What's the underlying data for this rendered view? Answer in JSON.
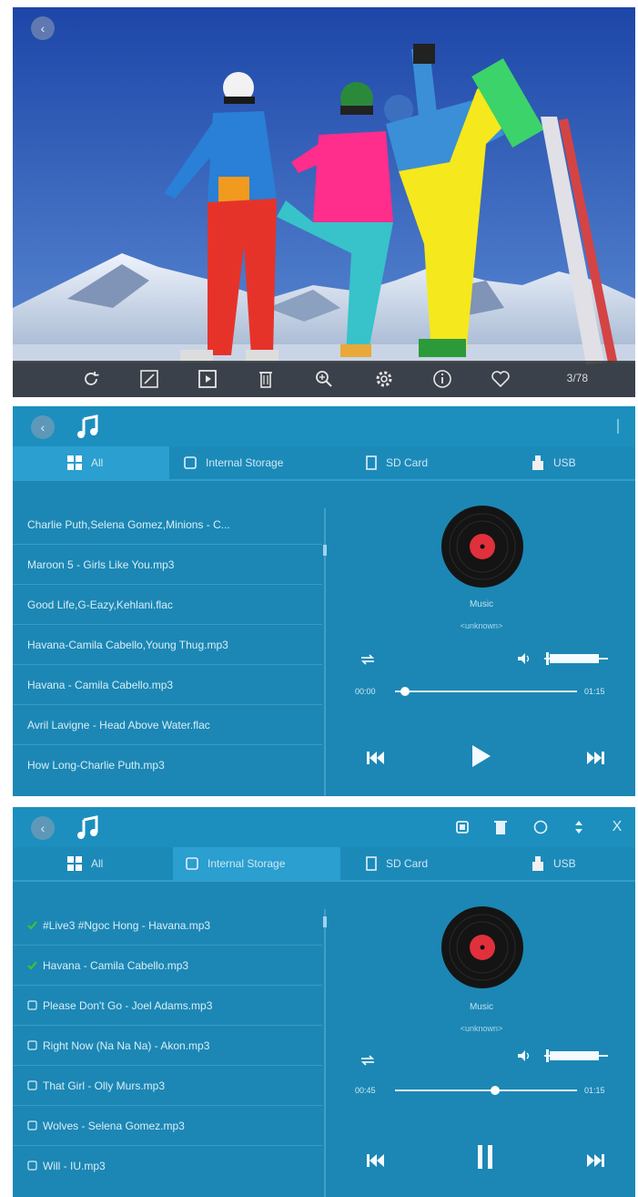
{
  "viewer": {
    "counter": "3/78",
    "toolbar_icons": [
      "rotate-icon",
      "fullscreen-icon",
      "slideshow-icon",
      "delete-icon",
      "zoom-icon",
      "settings-icon",
      "info-icon",
      "favorite-icon"
    ]
  },
  "music1": {
    "tabs": [
      {
        "label": "All",
        "icon": "grid-icon"
      },
      {
        "label": "Internal Storage",
        "icon": "storage-icon"
      },
      {
        "label": "SD Card",
        "icon": "sd-card-icon"
      },
      {
        "label": "USB",
        "icon": "usb-icon"
      }
    ],
    "active_tab": 0,
    "songs": [
      "Charlie Puth,Selena Gomez,Minions - C...",
      "Maroon 5 - Girls Like You.mp3",
      "Good Life,G-Eazy,Kehlani.flac",
      "Havana-Camila Cabello,Young Thug.mp3",
      "Havana - Camila Cabello.mp3",
      "Avril Lavigne - Head Above Water.flac",
      "How Long-Charlie Puth.mp3"
    ],
    "track_title": "Music",
    "track_artist": "<unknown>",
    "time_current": "00:00",
    "time_total": "01:15",
    "progress": 0.03,
    "volume": 0.85,
    "state": "paused"
  },
  "music2": {
    "tabs": [
      {
        "label": "All",
        "icon": "grid-icon"
      },
      {
        "label": "Internal Storage",
        "icon": "storage-icon"
      },
      {
        "label": "SD Card",
        "icon": "sd-card-icon"
      },
      {
        "label": "USB",
        "icon": "usb-icon"
      }
    ],
    "active_tab": 1,
    "top_actions": [
      "copy-icon",
      "delete-icon",
      "select-all-icon",
      "move-icon",
      "close-icon"
    ],
    "close_label": "X",
    "songs": [
      {
        "label": "#Live3 #Ngoc Hong - Havana.mp3",
        "checked": true
      },
      {
        "label": "Havana - Camila Cabello.mp3",
        "checked": true
      },
      {
        "label": "Please Don't Go - Joel Adams.mp3",
        "checked": false
      },
      {
        "label": "Right Now (Na Na Na) - Akon.mp3",
        "checked": false
      },
      {
        "label": "That Girl - Olly Murs.mp3",
        "checked": false
      },
      {
        "label": "Wolves - Selena Gomez.mp3",
        "checked": false
      },
      {
        "label": "Will - IU.mp3",
        "checked": false
      }
    ],
    "track_title": "Music",
    "track_artist": "<unknown>",
    "time_current": "00:45",
    "time_total": "01:15",
    "progress": 0.55,
    "volume": 0.85,
    "state": "playing"
  },
  "colors": {
    "panel_bg": "#1c87b4",
    "tab_active": "#2a9fd0",
    "vinyl_label": "#e0303c",
    "check_green": "#3ec13a"
  }
}
